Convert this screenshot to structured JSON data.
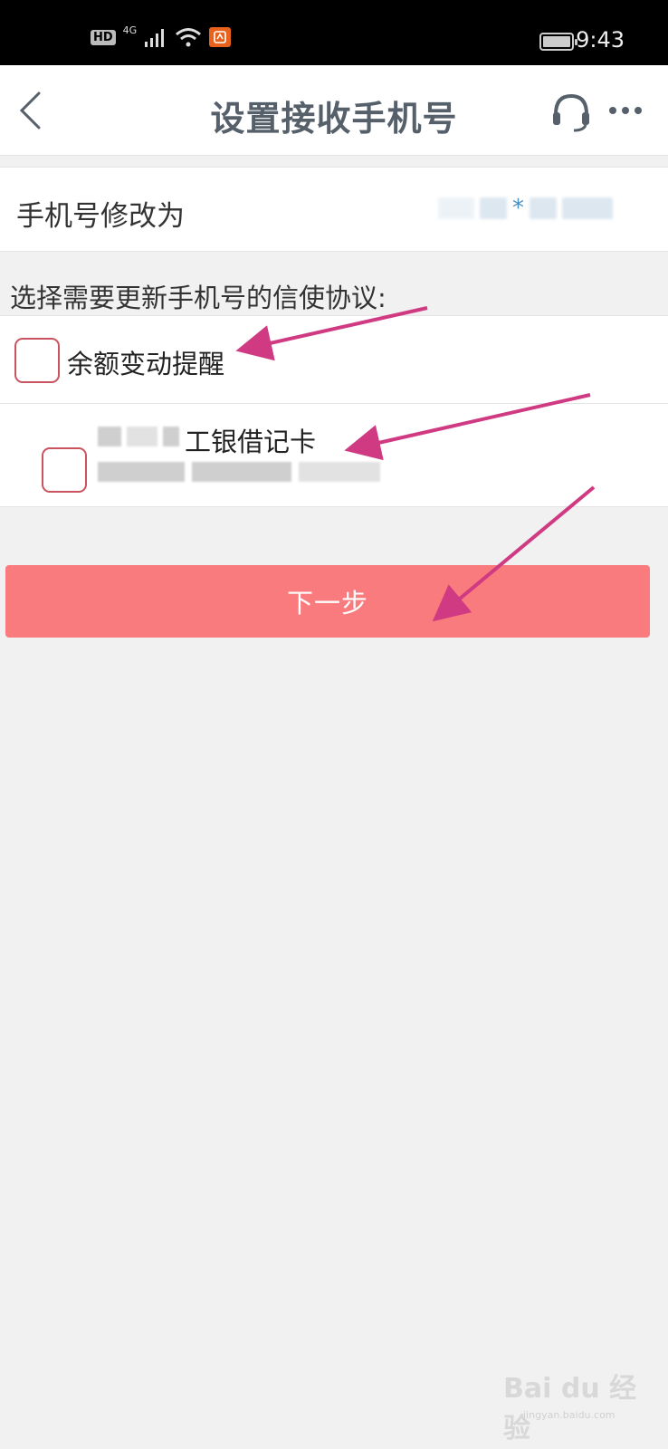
{
  "status_bar": {
    "hd": "HD",
    "network": "4G",
    "app_badge": "pn",
    "time": "9:43"
  },
  "nav": {
    "title": "设置接收手机号",
    "back_icon": "chevron-left-icon",
    "service_icon": "headset-icon",
    "more_icon": "more-horizontal-icon"
  },
  "phone_row": {
    "label": "手机号修改为",
    "value_masked": "*"
  },
  "section": {
    "title": "选择需要更新手机号的信使协议:"
  },
  "options": [
    {
      "label": "余额变动提醒",
      "checked": false
    },
    {
      "label": "工银借记卡",
      "checked": false
    }
  ],
  "next_button": {
    "label": "下一步"
  },
  "colors": {
    "button": "#f97b7e",
    "checkbox_border": "#c9545f",
    "arrow": "#d03a82",
    "title": "#56606a"
  },
  "watermark": {
    "brand": "Bai du 经验",
    "url": "jingyan.baidu.com"
  }
}
